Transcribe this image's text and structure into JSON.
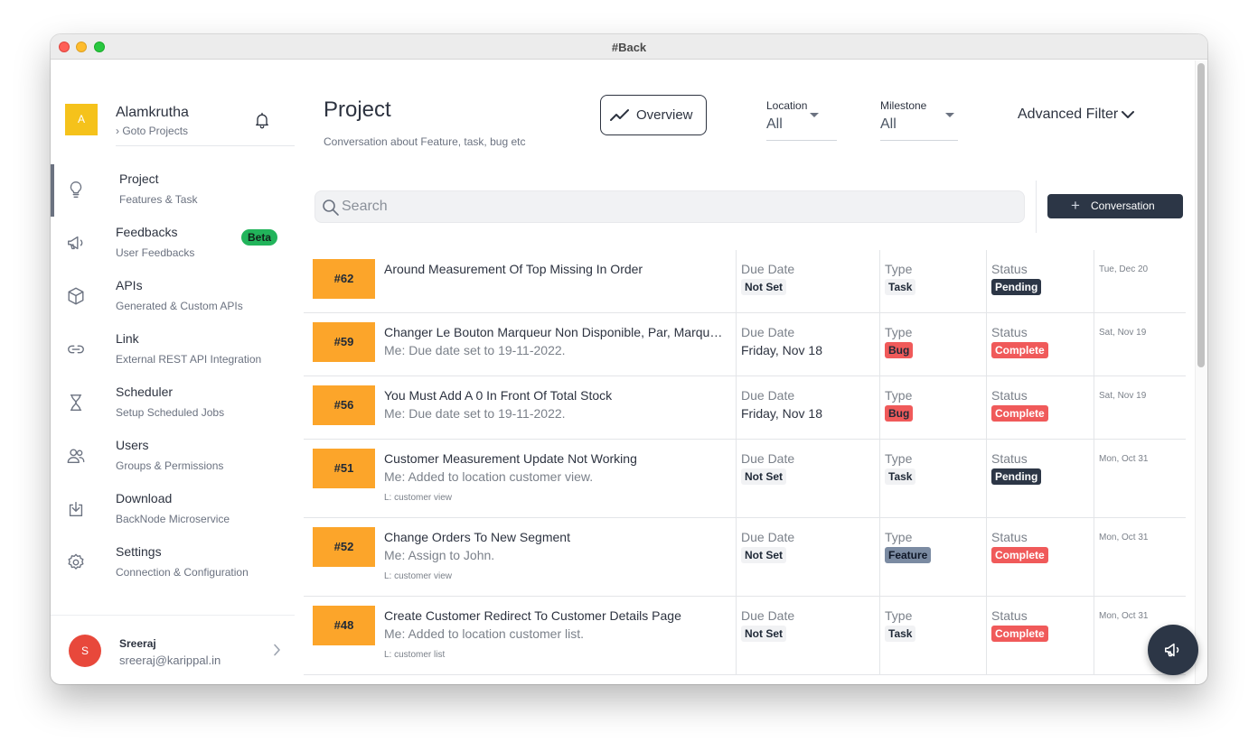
{
  "window": {
    "title": "#Back"
  },
  "org": {
    "initial": "A",
    "name": "Alamkrutha",
    "link": "› Goto Projects"
  },
  "nav": [
    {
      "title": "Project",
      "sub": "Features & Task"
    },
    {
      "title": "Feedbacks",
      "sub": "User Feedbacks",
      "badge": "Beta"
    },
    {
      "title": "APIs",
      "sub": "Generated & Custom APIs"
    },
    {
      "title": "Link",
      "sub": "External REST API Integration"
    },
    {
      "title": "Scheduler",
      "sub": "Setup Scheduled Jobs"
    },
    {
      "title": "Users",
      "sub": "Groups & Permissions"
    },
    {
      "title": "Download",
      "sub": "BackNode Microservice"
    },
    {
      "title": "Settings",
      "sub": "Connection & Configuration"
    }
  ],
  "user": {
    "initial": "S",
    "name": "Sreeraj",
    "email": "sreeraj@karippal.in"
  },
  "header": {
    "title": "Project",
    "subtitle": "Conversation about Feature, task, bug etc",
    "overview_label": "Overview",
    "location_label": "Location",
    "location_value": "All",
    "milestone_label": "Milestone",
    "milestone_value": "All",
    "advanced_filter": "Advanced Filter"
  },
  "search": {
    "placeholder": "Search"
  },
  "conversation_button": "Conversation",
  "columns": {
    "due": "Due Date",
    "type": "Type",
    "status": "Status"
  },
  "rows": [
    {
      "id": "#62",
      "title": "Around Measurement Of Top Missing In Order",
      "message": "",
      "location": "",
      "due": "Not Set",
      "type": "Task",
      "status": "Pending",
      "date": "Tue, Dec 20"
    },
    {
      "id": "#59",
      "title": "Changer Le Bouton Marqueur Non Disponible, Par, Marquer Comme Disponible",
      "message": "Me: Due date set to 19-11-2022.",
      "location": "",
      "due": "Friday, Nov 18",
      "type": "Bug",
      "status": "Complete",
      "date": "Sat, Nov 19"
    },
    {
      "id": "#56",
      "title": "You Must Add A 0 In Front Of Total Stock",
      "message": "Me: Due date set to 19-11-2022.",
      "location": "",
      "due": "Friday, Nov 18",
      "type": "Bug",
      "status": "Complete",
      "date": "Sat, Nov 19"
    },
    {
      "id": "#51",
      "title": "Customer Measurement Update Not Working",
      "message": "Me: Added to location customer view.",
      "location": "L: customer view",
      "due": "Not Set",
      "type": "Task",
      "status": "Pending",
      "date": "Mon, Oct 31"
    },
    {
      "id": "#52",
      "title": "Change Orders To New Segment",
      "message": "Me: Assign to John.",
      "location": "L: customer view",
      "due": "Not Set",
      "type": "Feature",
      "status": "Complete",
      "date": "Mon, Oct 31"
    },
    {
      "id": "#48",
      "title": "Create Customer Redirect To Customer Details Page",
      "message": "Me: Added to location customer list.",
      "location": "L: customer list",
      "due": "Not Set",
      "type": "Task",
      "status": "Complete",
      "date": "Mon, Oct 31"
    }
  ],
  "colors": {
    "accent": "#fca52a",
    "dark": "#2c3646",
    "danger": "#f05a5a",
    "beta": "#22b45b",
    "org_avatar": "#f5c21b",
    "user_avatar": "#e8483b"
  },
  "icons": [
    "bell-icon",
    "bulb-icon",
    "megaphone-icon",
    "cube-icon",
    "link-icon",
    "hourglass-icon",
    "users-icon",
    "download-icon",
    "gear-icon",
    "chevron-right-icon",
    "trend-icon",
    "chevron-down-icon",
    "search-icon",
    "plus-icon"
  ]
}
